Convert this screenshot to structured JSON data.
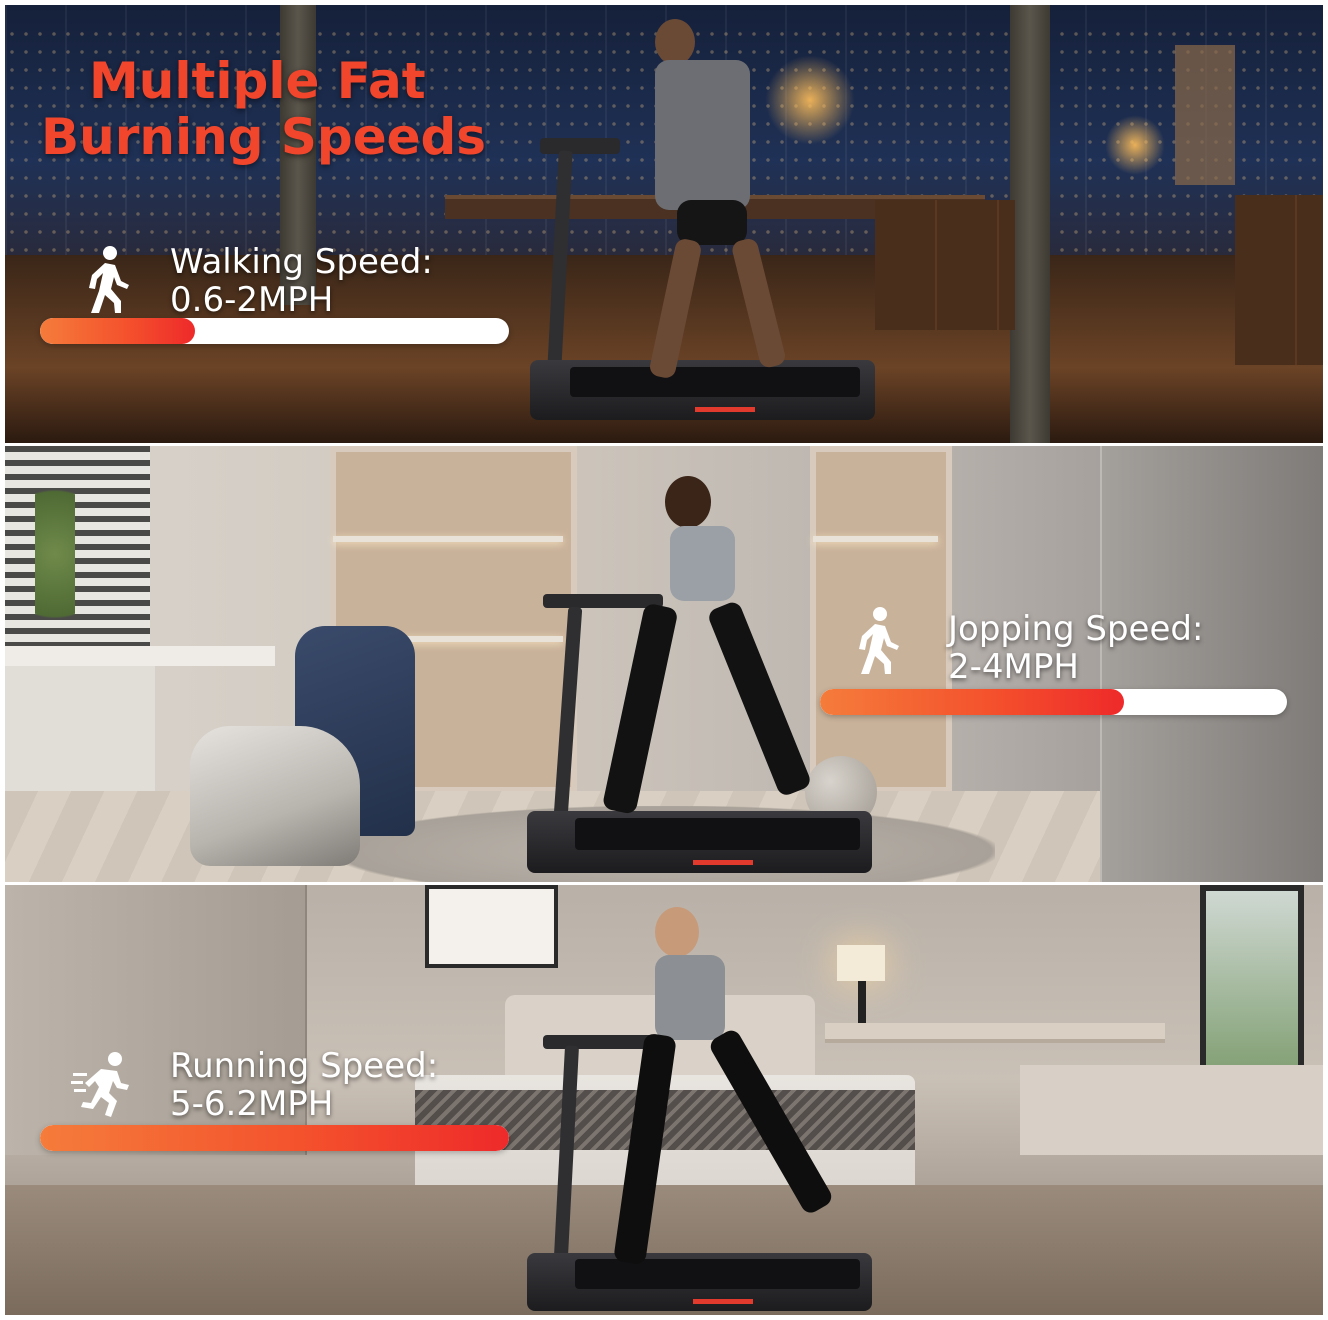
{
  "headline": {
    "line1": "Multiple Fat",
    "line2": "Burning Speeds"
  },
  "speeds": [
    {
      "label": "Walking Speed:",
      "range": "0.6-2MPH",
      "icon": "walking-person-icon",
      "fill_fraction": 0.33
    },
    {
      "label": "Jopping Speed:",
      "range": "2-4MPH",
      "icon": "walking-person-icon",
      "fill_fraction": 0.65
    },
    {
      "label": "Running Speed:",
      "range": "5-6.2MPH",
      "icon": "running-person-icon",
      "fill_fraction": 1.0
    }
  ],
  "colors": {
    "headline": "#f1462c",
    "bar_start": "#f57c3b",
    "bar_end": "#ee2a2a",
    "bar_track": "#ffffff"
  }
}
